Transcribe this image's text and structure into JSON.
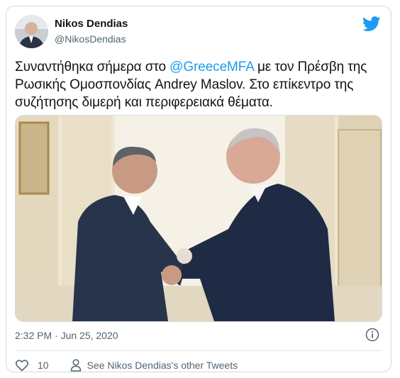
{
  "author": {
    "name": "Nikos Dendias",
    "handle": "@NikosDendias"
  },
  "tweet": {
    "text_before": "Συναντήθηκα σήμερα στο ",
    "mention": "@GreeceMFA",
    "text_after": " με τον Πρέσβη της Ρωσικής Ομοσπονδίας Andrey Maslov. Στο επίκεντρο της συζήτησης διμερή και περιφερειακά θέματα.",
    "timestamp": "2:32 PM · Jun 25, 2020"
  },
  "actions": {
    "like_count": "10",
    "see_more_label": "See Nikos Dendias's other Tweets"
  },
  "colors": {
    "accent": "#1d9bf0",
    "text": "#0f1419",
    "muted": "#536471",
    "like_icon": "#e0245e"
  },
  "icons": {
    "brand": "twitter-bird-icon",
    "info": "info-icon",
    "like": "heart-icon",
    "profile": "person-icon"
  }
}
